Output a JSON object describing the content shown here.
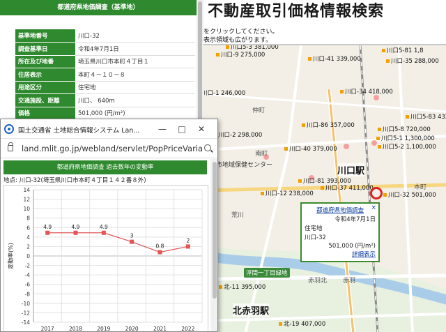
{
  "info_page": {
    "header": "都道府県地価調査（基準地）",
    "rows": [
      {
        "key": "基準地番号",
        "value": "川口-32"
      },
      {
        "key": "調査基準日",
        "value": "令和4年7月1日"
      },
      {
        "key": "所在及び地番",
        "value": "埼玉県川口市本町４丁目１"
      },
      {
        "key": "住居表示",
        "value": "本町４－１０－８"
      },
      {
        "key": "用途区分",
        "value": "住宅地"
      },
      {
        "key": "交通施設、距離",
        "value": "川口、 640m"
      },
      {
        "key": "価格",
        "value": "501,000 (円/m²)"
      }
    ]
  },
  "map_page": {
    "title": "不動産取引価格情報検索",
    "instruction1": "をクリックしてください。",
    "instruction2": "表示領域も広がります。",
    "price_labels": [
      "川口5-3 381,000",
      "川口-9 275,000",
      "川口-41 339,000",
      "川口-1 246,000",
      "川口-34 418,000",
      "川口-2 298,000",
      "川口-86 357,000",
      "川口-40 379,000",
      "川口-81 393,000",
      "川口-37 411,000",
      "川口-12 238,000",
      "川口-32 501,000",
      "北-11 395,000",
      "北-19 407,000",
      "川口5-1 1,300,000",
      "川口5-8 720,000",
      "川口5-2 1,100,000",
      "川口-35 288,000",
      "川口5-83 432",
      "川口5-81 1,8"
    ],
    "place_labels": [
      "市地域保健センター",
      "仲町",
      "南町",
      "荒川",
      "赤羽北",
      "赤羽",
      "本町"
    ],
    "stations": [
      "川口駅",
      "北赤羽駅"
    ],
    "green_labels": [
      "浮間一丁目緑地"
    ],
    "popup": {
      "title": "都道府県地価調査",
      "close": "×",
      "date": "令和4年7月1日",
      "use": "住宅地",
      "code": "川口-32",
      "price": "501,000 (円/m²)",
      "link": "詳細表示"
    }
  },
  "popup_window": {
    "title": "国土交通省 土地総合情報システム Lan...",
    "url": "land.mlit.go.jp/webland/servlet/PopPriceVariat...",
    "chart_header": "都道府県地価調査 過去数年の変動率",
    "location": "地点: 川口-32(埼玉県川口市本町４丁目１４２番８外)"
  },
  "chart_data": {
    "type": "line",
    "ylabel": "変動率(%)",
    "ylim": [
      -14,
      14
    ],
    "yticks": [
      14,
      12,
      10,
      8,
      6,
      4,
      2,
      0,
      -2,
      -4,
      -6,
      -8,
      -10,
      -12,
      -14
    ],
    "categories": [
      "2017",
      "2018",
      "2019",
      "2020",
      "2021",
      "2022"
    ],
    "values": [
      4.9,
      4.9,
      4.9,
      3,
      0.8,
      2
    ],
    "value_labels": [
      "4.9",
      "4.9",
      "4.9",
      "3",
      "0.8",
      "2"
    ],
    "color": "#e05555",
    "grid": true
  }
}
